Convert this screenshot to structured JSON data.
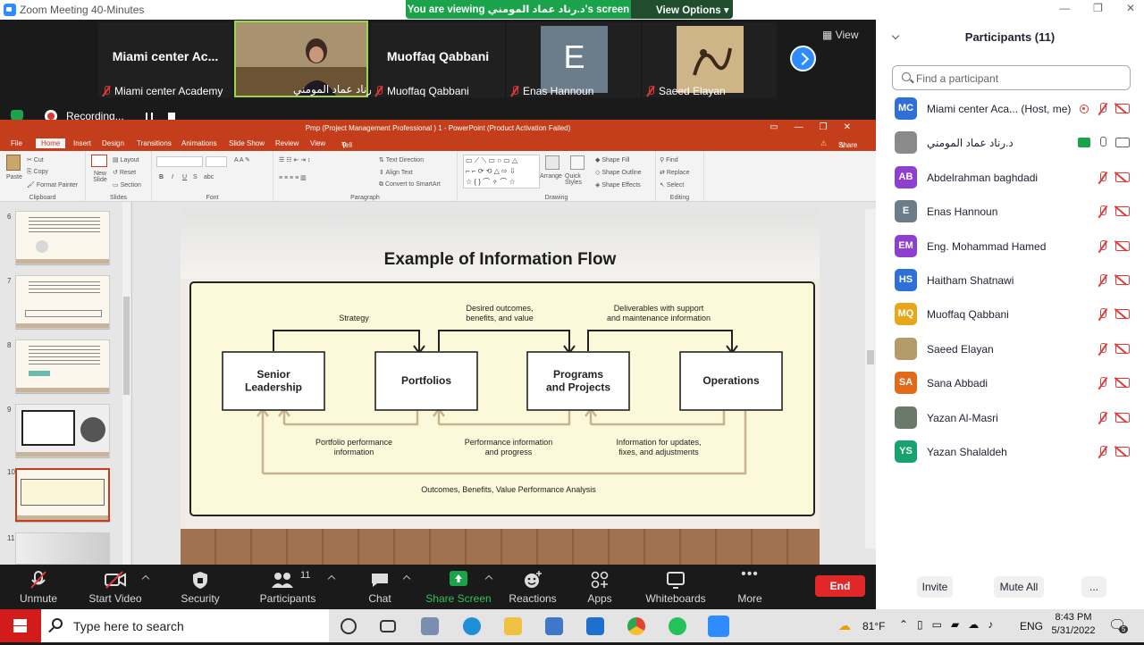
{
  "window": {
    "title": "Zoom Meeting 40-Minutes"
  },
  "share_banner": {
    "message": "You are viewing د.رناد عماد المومني's screen",
    "view_options": "View Options"
  },
  "video_strip": {
    "view_label": "View",
    "tiles": [
      {
        "name": "Miami center Ac...",
        "label": "Miami center Academy",
        "muted": true
      },
      {
        "name": "",
        "label": "د.رناد عماد المومني",
        "muted": false
      },
      {
        "name": "Muoffaq Qabbani",
        "label": "Muoffaq Qabbani",
        "muted": true
      },
      {
        "name": "E",
        "label": "Enas Hannoun",
        "muted": true
      },
      {
        "name": "",
        "label": "Saeed Elayan",
        "muted": true
      }
    ]
  },
  "recording": {
    "label": "Recording..."
  },
  "ppt": {
    "title": "Pmp (Project Management Professional ) 1 - PowerPoint (Product Activation Failed)",
    "tabs": [
      "File",
      "Home",
      "Insert",
      "Design",
      "Transitions",
      "Animations",
      "Slide Show",
      "Review",
      "View"
    ],
    "tell_me": "Tell me what you want to do...",
    "share": "Share",
    "ribbon": {
      "clipboard": {
        "paste": "Paste",
        "cut": "Cut",
        "copy": "Copy",
        "format_painter": "Format Painter",
        "label": "Clipboard"
      },
      "slides": {
        "new_slide": "New Slide",
        "layout": "Layout",
        "reset": "Reset",
        "section": "Section",
        "label": "Slides"
      },
      "font": {
        "label": "Font",
        "bold": "B",
        "italic": "I",
        "underline": "U",
        "strike": "S",
        "abc": "abc"
      },
      "paragraph": {
        "label": "Paragraph",
        "text_direction": "Text Direction",
        "align_text": "Align Text",
        "smartart": "Convert to SmartArt"
      },
      "drawing": {
        "label": "Drawing",
        "arrange": "Arrange",
        "quick_styles": "Quick Styles",
        "fill": "Shape Fill",
        "outline": "Shape Outline",
        "effects": "Shape Effects"
      },
      "editing": {
        "label": "Editing",
        "find": "Find",
        "replace": "Replace",
        "select": "Select"
      }
    },
    "thumbnails": [
      {
        "num": "6"
      },
      {
        "num": "7"
      },
      {
        "num": "8"
      },
      {
        "num": "9"
      },
      {
        "num": "10",
        "selected": true
      },
      {
        "num": "11"
      }
    ],
    "slide": {
      "title": "Example of Information Flow",
      "boxes": [
        "Senior Leadership",
        "Portfolios",
        "Programs and Projects",
        "Operations"
      ],
      "top_labels": [
        "Strategy",
        "Desired outcomes, benefits, and value",
        "Deliverables with support and maintenance information"
      ],
      "bottom_labels": [
        "Portfolio performance information",
        "Performance information and progress",
        "Information for updates, fixes, and adjustments"
      ],
      "footer": "Outcomes, Benefits, Value Performance Analysis"
    }
  },
  "toolbar": {
    "unmute": "Unmute",
    "start_video": "Start Video",
    "security": "Security",
    "participants": "Participants",
    "participants_count": "11",
    "chat": "Chat",
    "share_screen": "Share Screen",
    "reactions": "Reactions",
    "apps": "Apps",
    "whiteboards": "Whiteboards",
    "more": "More",
    "end": "End"
  },
  "panel": {
    "title": "Participants (11)",
    "search_placeholder": "Find a participant",
    "participants": [
      {
        "initials": "MC",
        "color": "#2f6fd8",
        "name": "Miami center Aca... (Host, me)",
        "recording": true
      },
      {
        "initials": "",
        "color": "#8a8a8a",
        "name": "د.رناد عماد المومني",
        "sharing": true,
        "mic_on": true,
        "video_on": true
      },
      {
        "initials": "AB",
        "color": "#8e3fcf",
        "name": "Abdelrahman baghdadi"
      },
      {
        "initials": "E",
        "color": "#6b7c8a",
        "name": "Enas Hannoun"
      },
      {
        "initials": "EM",
        "color": "#8e3fcf",
        "name": "Eng. Mohammad Hamed"
      },
      {
        "initials": "HS",
        "color": "#2f6fd8",
        "name": "Haitham Shatnawi"
      },
      {
        "initials": "MQ",
        "color": "#e9a61b",
        "name": "Muoffaq Qabbani"
      },
      {
        "initials": "",
        "color": "#b59a6a",
        "name": "Saeed Elayan"
      },
      {
        "initials": "SA",
        "color": "#e26a1b",
        "name": "Sana Abbadi"
      },
      {
        "initials": "",
        "color": "#6a7a6a",
        "name": "Yazan Al-Masri"
      },
      {
        "initials": "YS",
        "color": "#17a370",
        "name": "Yazan Shalaldeh"
      }
    ],
    "invite": "Invite",
    "mute_all": "Mute All",
    "more": "..."
  },
  "taskbar": {
    "search_placeholder": "Type here to search",
    "temperature": "81°F",
    "language": "ENG",
    "time": "8:43 PM",
    "date": "5/31/2022",
    "notifications": "5"
  }
}
